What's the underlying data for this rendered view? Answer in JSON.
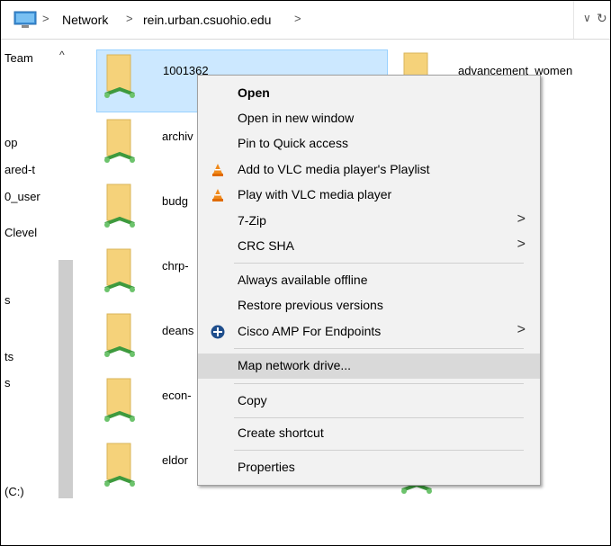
{
  "address": {
    "crumbs": [
      "Network",
      "rein.urban.csuohio.edu"
    ],
    "separator": ">",
    "dropdown_icon": "chevron-down-icon",
    "refresh_icon": "refresh-icon"
  },
  "nav": {
    "items": [
      "Team",
      "op",
      "ared-t",
      "0_user",
      "Clevel",
      "s",
      "ts",
      "s",
      "(C:)"
    ]
  },
  "files": [
    {
      "name": "1001362"
    },
    {
      "name": "archiv"
    },
    {
      "name": "budg"
    },
    {
      "name": "chrp-"
    },
    {
      "name": "deans"
    },
    {
      "name": "econ-"
    },
    {
      "name": "eldor"
    },
    {
      "name": "advancement_women"
    }
  ],
  "menu": {
    "items": [
      {
        "label": "Open",
        "bold": true
      },
      {
        "label": "Open in new window"
      },
      {
        "label": "Pin to Quick access"
      },
      {
        "label": "Add to VLC media player's Playlist",
        "icon": "vlc-icon"
      },
      {
        "label": "Play with VLC media player",
        "icon": "vlc-icon"
      },
      {
        "label": "7-Zip",
        "submenu": true
      },
      {
        "label": "CRC SHA",
        "submenu": true
      },
      {
        "label": "Always available offline"
      },
      {
        "label": "Restore previous versions"
      },
      {
        "label": "Cisco AMP For Endpoints",
        "icon": "cisco-amp-icon",
        "submenu": true
      },
      {
        "label": "Map network drive...",
        "highlighted": true
      },
      {
        "label": "Copy"
      },
      {
        "label": "Create shortcut"
      },
      {
        "label": "Properties"
      }
    ],
    "submenu_arrow": ">"
  },
  "colors": {
    "selection": "#cce8ff",
    "selection_border": "#99d1ff",
    "menu_bg": "#f2f2f2",
    "menu_hover": "#d9d9d9",
    "folder": "#f5d27a",
    "network_green": "#4caf50"
  }
}
